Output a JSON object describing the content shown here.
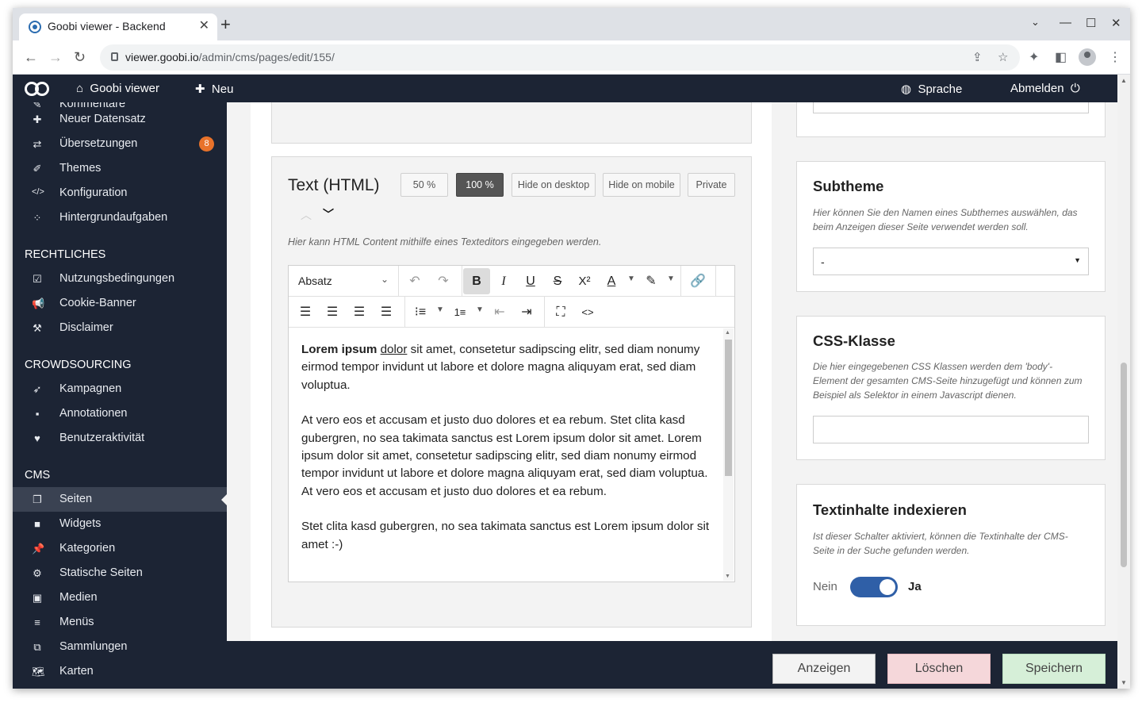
{
  "browser": {
    "tab_title": "Goobi viewer - Backend",
    "url_host": "viewer.goobi.io",
    "url_path": "/admin/cms/pages/edit/155/"
  },
  "topnav": {
    "home": "Goobi viewer",
    "new": "Neu",
    "language": "Sprache",
    "logout": "Abmelden"
  },
  "sidebar": {
    "partial_item": "Kommentare",
    "items_top": [
      {
        "label": "Neuer Datensatz",
        "icon": "plus-icon"
      },
      {
        "label": "Übersetzungen",
        "icon": "exchange-icon",
        "badge": "8"
      },
      {
        "label": "Themes",
        "icon": "brush-icon"
      },
      {
        "label": "Konfiguration",
        "icon": "code-icon"
      },
      {
        "label": "Hintergrundaufgaben",
        "icon": "spinner-icon"
      }
    ],
    "section_legal": "RECHTLICHES",
    "items_legal": [
      {
        "label": "Nutzungsbedingungen",
        "icon": "checkbox-icon"
      },
      {
        "label": "Cookie-Banner",
        "icon": "bullhorn-icon"
      },
      {
        "label": "Disclaimer",
        "icon": "gavel-icon"
      }
    ],
    "section_crowd": "CROWDSOURCING",
    "items_crowd": [
      {
        "label": "Kampagnen",
        "icon": "rocket-icon"
      },
      {
        "label": "Annotationen",
        "icon": "note-icon"
      },
      {
        "label": "Benutzeraktivität",
        "icon": "heartbeat-icon"
      }
    ],
    "section_cms": "CMS",
    "items_cms": [
      {
        "label": "Seiten",
        "icon": "pages-icon"
      },
      {
        "label": "Widgets",
        "icon": "widget-icon"
      },
      {
        "label": "Kategorien",
        "icon": "pin-icon"
      },
      {
        "label": "Statische Seiten",
        "icon": "cogs-icon"
      },
      {
        "label": "Medien",
        "icon": "image-icon"
      },
      {
        "label": "Menüs",
        "icon": "menu-icon"
      },
      {
        "label": "Sammlungen",
        "icon": "collection-icon"
      },
      {
        "label": "Karten",
        "icon": "map-icon"
      }
    ]
  },
  "widget": {
    "title": "Text (HTML)",
    "btn_50": "50 %",
    "btn_100": "100 %",
    "btn_hide_desktop": "Hide on desktop",
    "btn_hide_mobile": "Hide on mobile",
    "btn_private": "Private",
    "help": "Hier kann HTML Content mithilfe eines Texteditors eingegeben werden.",
    "format_select": "Absatz",
    "content": {
      "p1_bold": "Lorem ipsum",
      "p1_underline": "dolor",
      "p1_rest": " sit amet, consetetur sadipscing elitr, sed diam nonumy eirmod tempor invidunt ut labore et dolore magna aliquyam erat, sed diam voluptua.",
      "p2": "At vero eos et accusam et justo duo dolores et ea rebum. Stet clita kasd gubergren, no sea takimata sanctus est Lorem ipsum dolor sit amet. Lorem ipsum dolor sit amet, consetetur sadipscing elitr, sed diam nonumy eirmod tempor invidunt ut labore et dolore magna aliquyam erat, sed diam voluptua. At vero eos et accusam et justo duo dolores et ea rebum.",
      "p3": "Stet clita kasd gubergren, no sea takimata sanctus est Lorem ipsum dolor sit amet :-)"
    }
  },
  "right": {
    "subtheme": {
      "title": "Subtheme",
      "help": "Hier können Sie den Namen eines Subthemes auswählen, das beim Anzeigen dieser Seite verwendet werden soll.",
      "value": "-"
    },
    "css": {
      "title": "CSS-Klasse",
      "help": "Die hier eingegebenen CSS Klassen werden dem 'body'-Element der gesamten CMS-Seite hinzugefügt und können zum Beispiel als Selektor in einem Javascript dienen.",
      "value": ""
    },
    "index": {
      "title": "Textinhalte indexieren",
      "help": "Ist dieser Schalter aktiviert, können die Textinhalte der CMS-Seite in der Suche gefunden werden.",
      "off_label": "Nein",
      "on_label": "Ja",
      "enabled": true
    }
  },
  "footer": {
    "show": "Anzeigen",
    "delete": "Löschen",
    "save": "Speichern"
  },
  "colors": {
    "nav_bg": "#1c2434",
    "badge": "#e8722a",
    "toggle_on": "#2f5fa7",
    "delete_bg": "#f5d7da",
    "save_bg": "#d6efd8"
  }
}
